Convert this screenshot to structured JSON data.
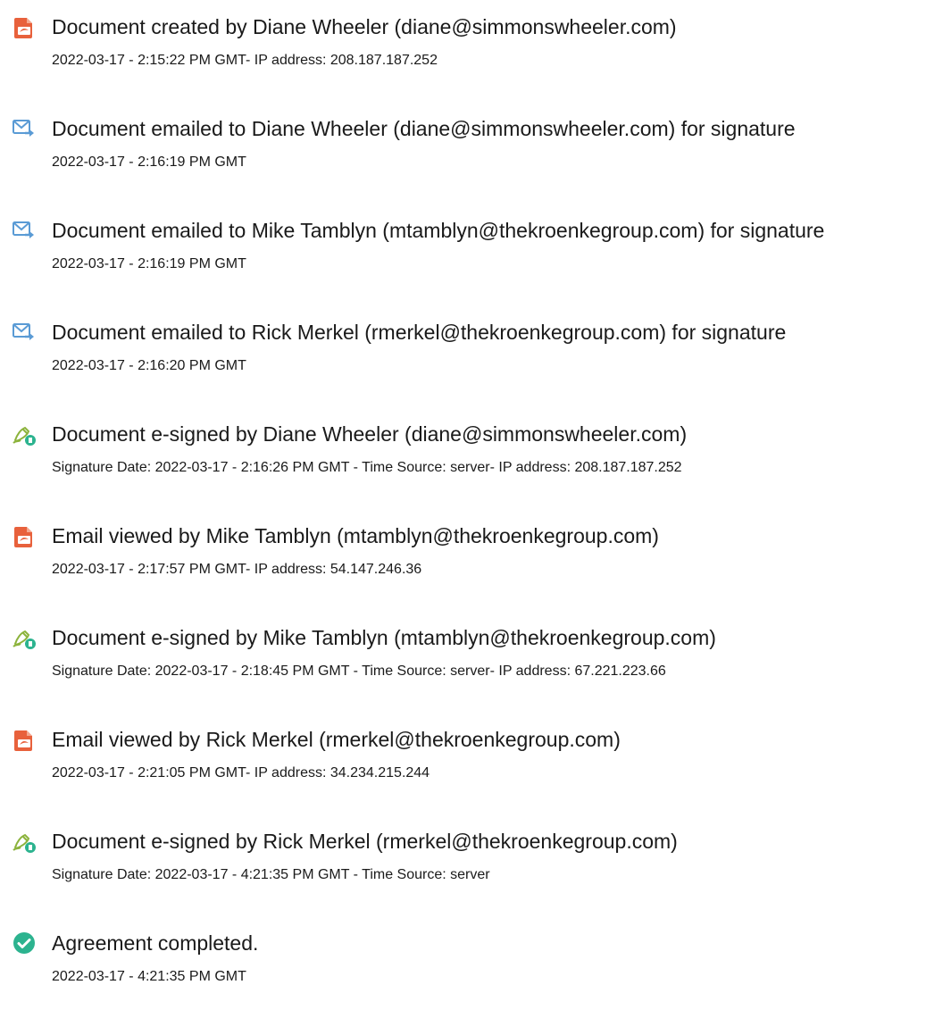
{
  "colors": {
    "pdf_icon": "#e8613c",
    "email_icon": "#5a9bd5",
    "esign_icon": "#8cb33c",
    "complete_icon": "#2cb38f"
  },
  "events": [
    {
      "icon": "pdf-icon",
      "title": "Document created by Diane Wheeler (diane@simmonswheeler.com)",
      "detail": "2022-03-17 - 2:15:22 PM GMT- IP address: 208.187.187.252"
    },
    {
      "icon": "email-icon",
      "title": "Document emailed to Diane Wheeler (diane@simmonswheeler.com) for signature",
      "detail": "2022-03-17 - 2:16:19 PM GMT"
    },
    {
      "icon": "email-icon",
      "title": "Document emailed to Mike Tamblyn (mtamblyn@thekroenkegroup.com) for signature",
      "detail": "2022-03-17 - 2:16:19 PM GMT"
    },
    {
      "icon": "email-icon",
      "title": "Document emailed to Rick Merkel (rmerkel@thekroenkegroup.com) for signature",
      "detail": "2022-03-17 - 2:16:20 PM GMT"
    },
    {
      "icon": "esign-icon",
      "title": "Document e-signed by Diane Wheeler (diane@simmonswheeler.com)",
      "detail": "Signature Date: 2022-03-17 - 2:16:26 PM GMT - Time Source: server- IP address: 208.187.187.252"
    },
    {
      "icon": "pdf-icon",
      "title": "Email viewed by Mike Tamblyn (mtamblyn@thekroenkegroup.com)",
      "detail": "2022-03-17 - 2:17:57 PM GMT- IP address: 54.147.246.36"
    },
    {
      "icon": "esign-icon",
      "title": "Document e-signed by Mike Tamblyn (mtamblyn@thekroenkegroup.com)",
      "detail": "Signature Date: 2022-03-17 - 2:18:45 PM GMT - Time Source: server- IP address: 67.221.223.66"
    },
    {
      "icon": "pdf-icon",
      "title": "Email viewed by Rick Merkel (rmerkel@thekroenkegroup.com)",
      "detail": "2022-03-17 - 2:21:05 PM GMT- IP address: 34.234.215.244"
    },
    {
      "icon": "esign-icon",
      "title": "Document e-signed by Rick Merkel (rmerkel@thekroenkegroup.com)",
      "detail": "Signature Date: 2022-03-17 - 4:21:35 PM GMT - Time Source: server"
    },
    {
      "icon": "check-circle-icon",
      "title": "Agreement completed.",
      "detail": "2022-03-17 - 4:21:35 PM GMT"
    }
  ]
}
